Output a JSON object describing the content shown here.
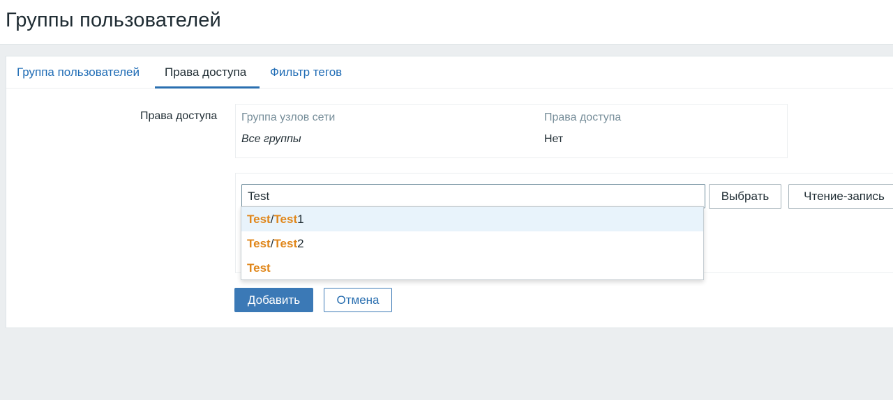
{
  "page": {
    "title": "Группы пользователей"
  },
  "tabs": [
    {
      "label": "Группа пользователей",
      "active": false
    },
    {
      "label": "Права доступа",
      "active": true
    },
    {
      "label": "Фильтр тегов",
      "active": false
    }
  ],
  "permissions": {
    "label": "Права доступа",
    "table": {
      "headers": [
        "Группа узлов сети",
        "Права доступа"
      ],
      "rows": [
        [
          "Все группы",
          "Нет"
        ]
      ]
    }
  },
  "add_permission": {
    "search_value": "Test",
    "select_button": "Выбрать",
    "permission_button": "Чтение-запись",
    "suggestions": [
      {
        "parts": [
          {
            "t": "Test",
            "hl": true
          },
          {
            "t": "/",
            "hl": false
          },
          {
            "t": "Test",
            "hl": true
          },
          {
            "t": "1",
            "hl": false
          }
        ]
      },
      {
        "parts": [
          {
            "t": "Test",
            "hl": true
          },
          {
            "t": "/",
            "hl": false
          },
          {
            "t": "Test",
            "hl": true
          },
          {
            "t": "2",
            "hl": false
          }
        ]
      },
      {
        "parts": [
          {
            "t": "Test",
            "hl": true
          }
        ]
      }
    ]
  },
  "actions": {
    "add": "Добавить",
    "cancel": "Отмена"
  },
  "colors": {
    "accent": "#3b79b6",
    "link": "#1f6cb5",
    "highlight": "#e0871b",
    "background": "#ebeef0"
  }
}
